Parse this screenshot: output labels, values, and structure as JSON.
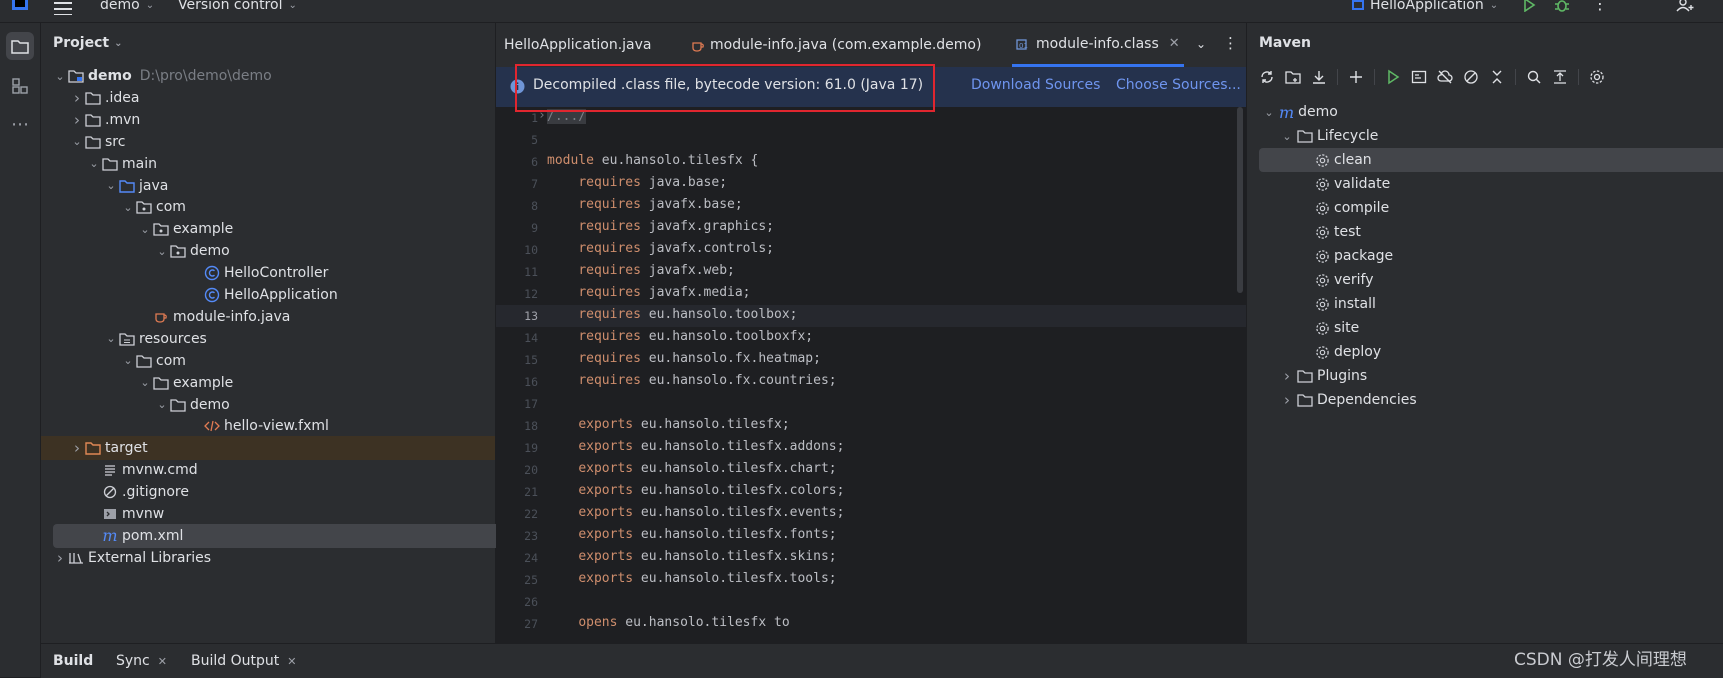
{
  "titlebar": {
    "project_name": "demo",
    "vcs_label": "Version control",
    "run_config": "HelloApplication"
  },
  "project_panel": {
    "title": "Project",
    "tree": [
      {
        "label": "demo",
        "path": "D:\\pro\\demo\\demo",
        "icon": "module-folder-icon",
        "level": 0,
        "chevron": "down"
      },
      {
        "label": ".idea",
        "icon": "folder-icon",
        "level": 1,
        "chevron": "right"
      },
      {
        "label": ".mvn",
        "icon": "folder-icon",
        "level": 1,
        "chevron": "right"
      },
      {
        "label": "src",
        "icon": "folder-icon",
        "level": 1,
        "chevron": "down"
      },
      {
        "label": "main",
        "icon": "folder-icon",
        "level": 2,
        "chevron": "down"
      },
      {
        "label": "java",
        "icon": "source-folder-icon",
        "level": 3,
        "chevron": "down"
      },
      {
        "label": "com",
        "icon": "package-icon",
        "level": 4,
        "chevron": "down"
      },
      {
        "label": "example",
        "icon": "package-icon",
        "level": 5,
        "chevron": "down"
      },
      {
        "label": "demo",
        "icon": "package-icon",
        "level": 6,
        "chevron": "down"
      },
      {
        "label": "HelloController",
        "icon": "class-icon",
        "level": 8,
        "chevron": ""
      },
      {
        "label": "HelloApplication",
        "icon": "class-icon",
        "level": 8,
        "chevron": ""
      },
      {
        "label": "module-info.java",
        "icon": "java-file-icon",
        "level": 5,
        "chevron": ""
      },
      {
        "label": "resources",
        "icon": "resources-folder-icon",
        "level": 3,
        "chevron": "down"
      },
      {
        "label": "com",
        "icon": "folder-icon",
        "level": 4,
        "chevron": "down"
      },
      {
        "label": "example",
        "icon": "folder-icon",
        "level": 5,
        "chevron": "down"
      },
      {
        "label": "demo",
        "icon": "folder-icon",
        "level": 6,
        "chevron": "down"
      },
      {
        "label": "hello-view.fxml",
        "icon": "fxml-file-icon",
        "level": 8,
        "chevron": ""
      },
      {
        "label": "target",
        "icon": "excluded-folder-icon",
        "level": 1,
        "chevron": "right",
        "excluded": true
      },
      {
        "label": "mvnw.cmd",
        "icon": "text-file-icon",
        "level": 2,
        "chevron": ""
      },
      {
        "label": ".gitignore",
        "icon": "ignore-file-icon",
        "level": 2,
        "chevron": ""
      },
      {
        "label": "mvnw",
        "icon": "shell-file-icon",
        "level": 2,
        "chevron": ""
      },
      {
        "label": "pom.xml",
        "icon": "maven-icon",
        "level": 2,
        "chevron": "",
        "selected": true
      },
      {
        "label": "External Libraries",
        "icon": "library-icon",
        "level": 0,
        "chevron": "right"
      }
    ]
  },
  "editor": {
    "tabs": [
      {
        "label": "HelloApplication.java",
        "active": false,
        "icon": ""
      },
      {
        "label": "module-info.java (com.example.demo)",
        "active": false,
        "icon": "java-file-icon"
      },
      {
        "label": "module-info.class",
        "active": true,
        "icon": "class-file-icon",
        "closable": true
      }
    ],
    "banner": {
      "message": "Decompiled .class file, bytecode version: 61.0 (Java 17)",
      "download_sources": "Download Sources",
      "choose_sources": "Choose Sources..."
    },
    "lines": [
      {
        "num": "1",
        "text": "/.../"
      },
      {
        "num": "5",
        "text": ""
      },
      {
        "num": "6",
        "text": "module eu.hansolo.tilesfx {"
      },
      {
        "num": "7",
        "text": "    requires java.base;"
      },
      {
        "num": "8",
        "text": "    requires javafx.base;"
      },
      {
        "num": "9",
        "text": "    requires javafx.graphics;"
      },
      {
        "num": "10",
        "text": "    requires javafx.controls;"
      },
      {
        "num": "11",
        "text": "    requires javafx.web;"
      },
      {
        "num": "12",
        "text": "    requires javafx.media;"
      },
      {
        "num": "13",
        "text": "    requires eu.hansolo.toolbox;"
      },
      {
        "num": "14",
        "text": "    requires eu.hansolo.toolboxfx;"
      },
      {
        "num": "15",
        "text": "    requires eu.hansolo.fx.heatmap;"
      },
      {
        "num": "16",
        "text": "    requires eu.hansolo.fx.countries;"
      },
      {
        "num": "17",
        "text": ""
      },
      {
        "num": "18",
        "text": "    exports eu.hansolo.tilesfx;"
      },
      {
        "num": "19",
        "text": "    exports eu.hansolo.tilesfx.addons;"
      },
      {
        "num": "20",
        "text": "    exports eu.hansolo.tilesfx.chart;"
      },
      {
        "num": "21",
        "text": "    exports eu.hansolo.tilesfx.colors;"
      },
      {
        "num": "22",
        "text": "    exports eu.hansolo.tilesfx.events;"
      },
      {
        "num": "23",
        "text": "    exports eu.hansolo.tilesfx.fonts;"
      },
      {
        "num": "24",
        "text": "    exports eu.hansolo.tilesfx.skins;"
      },
      {
        "num": "25",
        "text": "    exports eu.hansolo.tilesfx.tools;"
      },
      {
        "num": "26",
        "text": ""
      },
      {
        "num": "27",
        "text": "    opens eu.hansolo.tilesfx to"
      }
    ]
  },
  "maven": {
    "title": "Maven",
    "tree": [
      {
        "label": "demo",
        "level": 0,
        "chevron": "down",
        "icon": "maven-icon"
      },
      {
        "label": "Lifecycle",
        "level": 1,
        "chevron": "down",
        "icon": "folder-icon"
      },
      {
        "label": "clean",
        "level": 2,
        "chevron": "",
        "icon": "gear-icon",
        "selected": true
      },
      {
        "label": "validate",
        "level": 2,
        "chevron": "",
        "icon": "gear-icon"
      },
      {
        "label": "compile",
        "level": 2,
        "chevron": "",
        "icon": "gear-icon"
      },
      {
        "label": "test",
        "level": 2,
        "chevron": "",
        "icon": "gear-icon"
      },
      {
        "label": "package",
        "level": 2,
        "chevron": "",
        "icon": "gear-icon"
      },
      {
        "label": "verify",
        "level": 2,
        "chevron": "",
        "icon": "gear-icon"
      },
      {
        "label": "install",
        "level": 2,
        "chevron": "",
        "icon": "gear-icon"
      },
      {
        "label": "site",
        "level": 2,
        "chevron": "",
        "icon": "gear-icon"
      },
      {
        "label": "deploy",
        "level": 2,
        "chevron": "",
        "icon": "gear-icon"
      },
      {
        "label": "Plugins",
        "level": 1,
        "chevron": "right",
        "icon": "folder-icon"
      },
      {
        "label": "Dependencies",
        "level": 1,
        "chevron": "right",
        "icon": "folder-icon"
      }
    ]
  },
  "bottom": {
    "tabs": [
      {
        "label": "Build",
        "active": true
      },
      {
        "label": "Sync",
        "closable": true
      },
      {
        "label": "Build Output",
        "closable": true
      }
    ],
    "watermark": "CSDN @打发人间理想"
  },
  "colors": {
    "accent": "#3574f0",
    "highlight_box": "#e0262f",
    "keyword": "#cf8e6d"
  }
}
